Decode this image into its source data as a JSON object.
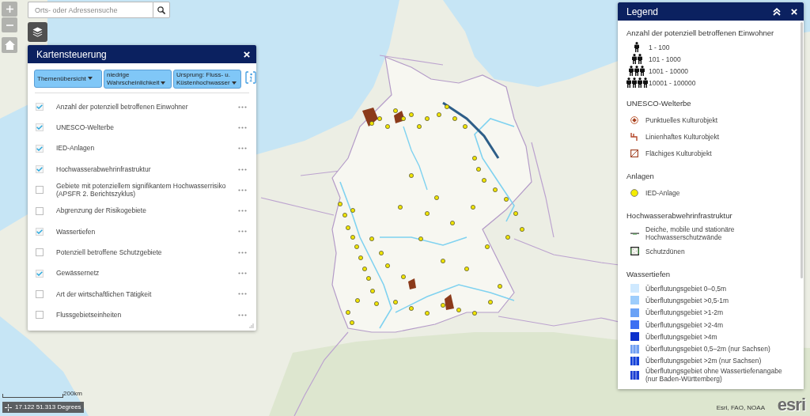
{
  "search": {
    "placeholder": "Orts- oder Adressensuche"
  },
  "layer_panel": {
    "title": "Kartensteuerung",
    "filters": [
      {
        "label": "Themenübersicht"
      },
      {
        "label": "niedrige Wahrscheinlichkeit"
      },
      {
        "label": "Ursprung: Fluss- u. Küstenhochwasser"
      }
    ],
    "layers": [
      {
        "label": "Anzahl der potenziell betroffenen Einwohner",
        "checked": true
      },
      {
        "label": "UNESCO-Welterbe",
        "checked": true
      },
      {
        "label": "IED-Anlagen",
        "checked": true
      },
      {
        "label": "Hochwasserabwehrinfrastruktur",
        "checked": true
      },
      {
        "label": "Gebiete mit potenziellem signifikantem Hochwasserrisiko (APSFR 2. Berichtszyklus)",
        "checked": false
      },
      {
        "label": "Abgrenzung der Risikogebiete",
        "checked": false
      },
      {
        "label": "Wassertiefen",
        "checked": true
      },
      {
        "label": "Potenziell betroffene Schutzgebiete",
        "checked": false
      },
      {
        "label": "Gewässernetz",
        "checked": true
      },
      {
        "label": "Art der wirtschaftlichen Tätigkeit",
        "checked": false
      },
      {
        "label": "Flussgebietseinheiten",
        "checked": false
      }
    ]
  },
  "legend": {
    "title": "Legend",
    "sections": [
      {
        "heading": "Anzahl der potenziell betroffenen Einwohner",
        "items": [
          {
            "kind": "people",
            "label": "1 - 100"
          },
          {
            "kind": "people",
            "label": "101 - 1000"
          },
          {
            "kind": "people",
            "label": "1001 - 10000"
          },
          {
            "kind": "people",
            "label": "10001 - 100000"
          }
        ]
      },
      {
        "heading": "UNESCO-Welterbe",
        "items": [
          {
            "kind": "point",
            "label": "Punktuelles Kulturobjekt"
          },
          {
            "kind": "line",
            "label": "Linienhaftes Kulturobjekt"
          },
          {
            "kind": "area",
            "label": "Flächiges Kulturobjekt"
          }
        ]
      },
      {
        "heading": "Anlagen",
        "items": [
          {
            "kind": "facility",
            "label": "IED-Anlage"
          }
        ]
      },
      {
        "heading": "Hochwasserabwehrinfrastruktur",
        "items": [
          {
            "kind": "dike",
            "label": "Deiche, mobile und stationäre Hochwasserschutzwände"
          },
          {
            "kind": "dune",
            "label": "Schutzdünen"
          }
        ]
      },
      {
        "heading": "Wassertiefen",
        "items": [
          {
            "kind": "fill",
            "color": "#cfe9ff",
            "label": "Überflutungsgebiet 0–0,5m"
          },
          {
            "kind": "fill",
            "color": "#9dcdfc",
            "label": "Überflutungsgebiet >0,5-1m"
          },
          {
            "kind": "fill",
            "color": "#6aa2f6",
            "label": "Überflutungsgebiet >1-2m"
          },
          {
            "kind": "fill",
            "color": "#3d6ff2",
            "label": "Überflutungsgebiet >2-4m"
          },
          {
            "kind": "fill",
            "color": "#0b31cc",
            "label": "Überflutungsgebiet >4m"
          },
          {
            "kind": "striped",
            "color": "#6f9ff2",
            "label": "Überflutungsgebiet 0,5–2m (nur Sachsen)"
          },
          {
            "kind": "striped",
            "color": "#1240d8",
            "label": "Überflutungsgebiet >2m (nur Sachsen)"
          },
          {
            "kind": "striped",
            "color": "#1a3dd2",
            "label": "Überflutungsgebiet ohne Wassertiefenangabe (nur Baden-Württemberg)"
          }
        ]
      }
    ]
  },
  "scale_bar": {
    "label": "200km"
  },
  "coordinates": "17.122 51.313 Degrees",
  "attribution": "Esri, FAO, NOAA",
  "logo": "esri"
}
